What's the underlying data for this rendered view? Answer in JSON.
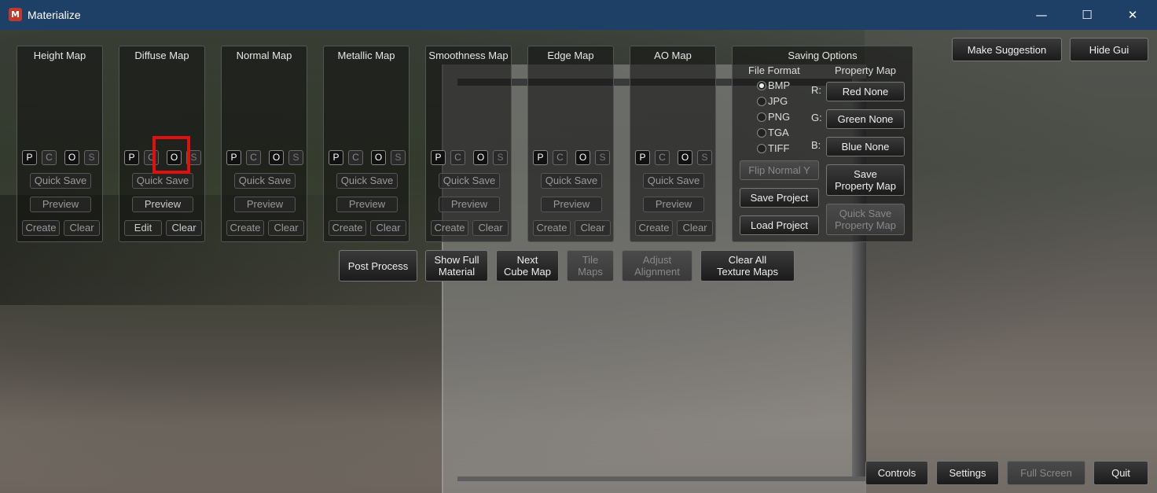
{
  "window": {
    "title": "Materialize",
    "minimize": "—",
    "maximize": "☐",
    "close": "✕"
  },
  "top_right": {
    "make_suggestion": "Make Suggestion",
    "hide_gui": "Hide Gui"
  },
  "map_panels": [
    {
      "title": "Height Map",
      "quick_save": "Quick Save",
      "preview": "Preview",
      "create": "Create",
      "clear": "Clear"
    },
    {
      "title": "Diffuse Map",
      "quick_save": "Quick Save",
      "preview": "Preview",
      "create": "Edit",
      "clear": "Clear"
    },
    {
      "title": "Normal Map",
      "quick_save": "Quick Save",
      "preview": "Preview",
      "create": "Create",
      "clear": "Clear"
    },
    {
      "title": "Metallic Map",
      "quick_save": "Quick Save",
      "preview": "Preview",
      "create": "Create",
      "clear": "Clear"
    },
    {
      "title": "Smoothness Map",
      "quick_save": "Quick Save",
      "preview": "Preview",
      "create": "Create",
      "clear": "Clear"
    },
    {
      "title": "Edge Map",
      "quick_save": "Quick Save",
      "preview": "Preview",
      "create": "Create",
      "clear": "Clear"
    },
    {
      "title": "AO Map",
      "quick_save": "Quick Save",
      "preview": "Preview",
      "create": "Create",
      "clear": "Clear"
    }
  ],
  "pcos": {
    "p": "P",
    "c": "C",
    "o": "O",
    "s": "S"
  },
  "saving_options": {
    "title": "Saving Options",
    "file_format_label": "File Format",
    "property_map_label": "Property Map",
    "formats": [
      "BMP",
      "JPG",
      "PNG",
      "TGA",
      "TIFF"
    ],
    "selected_format": "BMP",
    "r_label": "R:",
    "g_label": "G:",
    "b_label": "B:",
    "red": "Red None",
    "green": "Green None",
    "blue": "Blue None",
    "flip_normal": "Flip Normal Y",
    "save_project": "Save Project",
    "load_project": "Load Project",
    "save_property_map_1": "Save",
    "save_property_map_2": "Property Map",
    "quick_save_property_1": "Quick Save",
    "quick_save_property_2": "Property Map"
  },
  "actions": {
    "post_process": "Post Process",
    "show_full_1": "Show Full",
    "show_full_2": "Material",
    "next_cube_1": "Next",
    "next_cube_2": "Cube Map",
    "tile_1": "Tile",
    "tile_2": "Maps",
    "adjust_1": "Adjust",
    "adjust_2": "Alignment",
    "clear_all_1": "Clear All",
    "clear_all_2": "Texture Maps"
  },
  "bottom": {
    "controls": "Controls",
    "settings": "Settings",
    "full_screen": "Full Screen",
    "quit": "Quit"
  }
}
